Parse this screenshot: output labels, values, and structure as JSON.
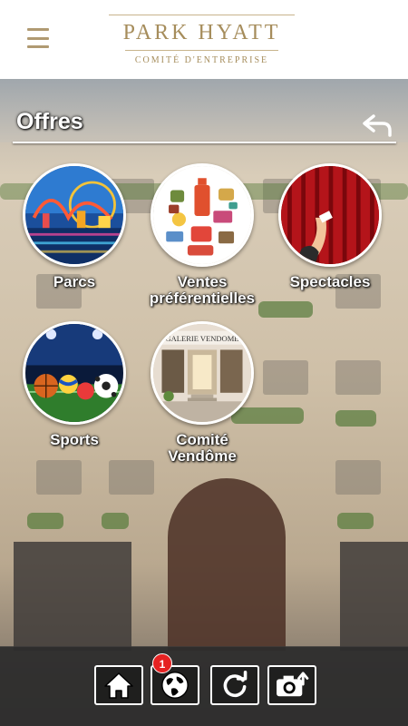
{
  "header": {
    "brand_title": "PARK HYATT",
    "brand_subtitle": "COMITÉ D'ENTREPRISE",
    "menu_icon": "hamburger-menu-icon"
  },
  "page": {
    "title": "Offres",
    "back_icon": "back-arrow-icon"
  },
  "offers": [
    {
      "label": "Parcs",
      "icon": "amusement-park-image"
    },
    {
      "label": "Ventes préférentielles",
      "icon": "shopping-items-image"
    },
    {
      "label": "Spectacles",
      "icon": "theater-curtain-image"
    },
    {
      "label": "Sports",
      "icon": "sports-balls-image"
    },
    {
      "label": "Comité Vendôme",
      "icon": "galerie-vendome-image"
    }
  ],
  "bottom_nav": {
    "items": [
      {
        "name": "home",
        "icon": "home-icon"
      },
      {
        "name": "globe",
        "icon": "globe-icon",
        "badge": "1"
      },
      {
        "name": "refresh",
        "icon": "refresh-icon"
      },
      {
        "name": "camera",
        "icon": "camera-upload-icon"
      }
    ]
  },
  "colors": {
    "brand_gold": "#a68d5c",
    "badge_red": "#e52222"
  }
}
